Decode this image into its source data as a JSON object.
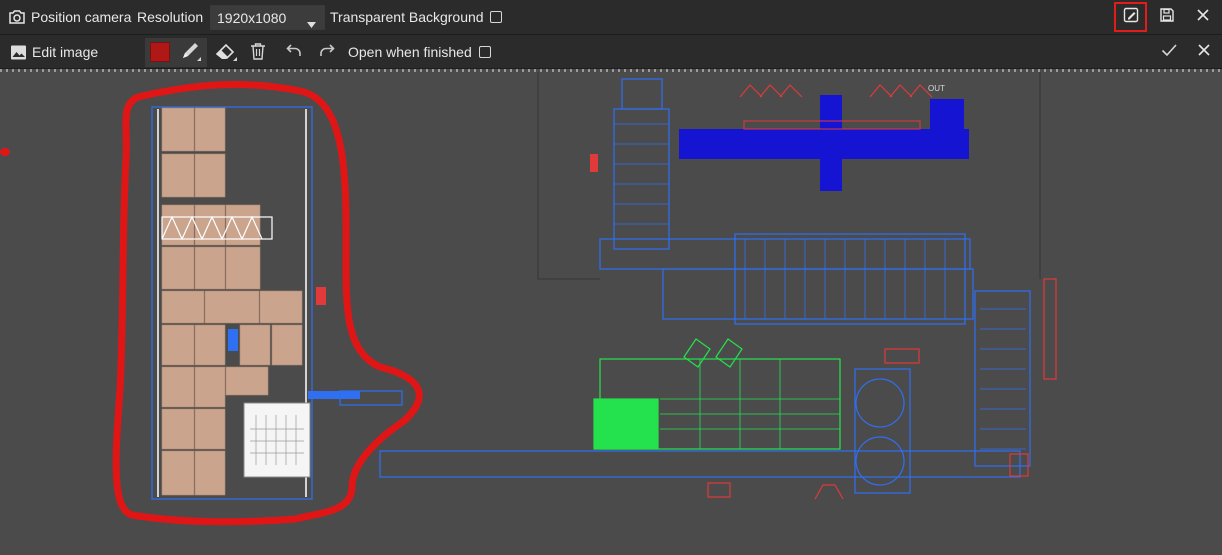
{
  "toolbar": {
    "camera_icon": "camera-icon",
    "position_camera_label": "Position camera",
    "resolution_label": "Resolution",
    "resolution_value": "1920x1080",
    "transparent_bg_label": "Transparent Background",
    "transparent_bg_checked": false,
    "highlight_color": "#e21b1b"
  },
  "edit_bar": {
    "edit_image_label": "Edit image",
    "color_swatch": "#b01818",
    "open_when_finished_label": "Open when finished",
    "open_when_finished_checked": false
  },
  "drawing": {
    "out_label": "OUT",
    "annotation_color": "#e01616",
    "colors": {
      "blue": "#2f6ff2",
      "green": "#24e24d",
      "red_marks": "#e03a3a",
      "boxes": "#caa48c"
    }
  }
}
